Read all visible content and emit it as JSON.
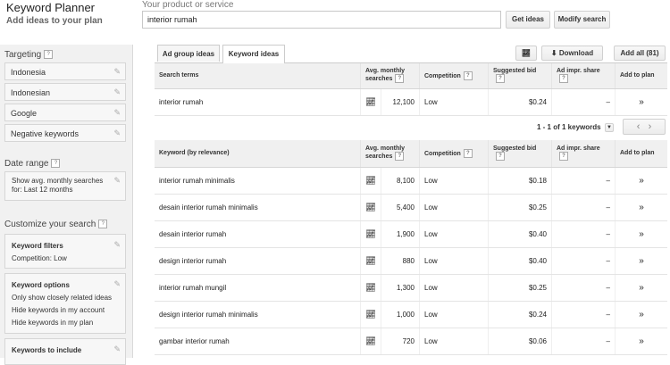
{
  "header": {
    "title": "Keyword Planner",
    "subtitle": "Add ideas to your plan",
    "product_label": "Your product or service",
    "search_value": "interior rumah",
    "get_ideas": "Get ideas",
    "modify_search": "Modify search"
  },
  "sidebar": {
    "targeting_label": "Targeting",
    "targeting": [
      "Indonesia",
      "Indonesian",
      "Google",
      "Negative keywords"
    ],
    "date_range_label": "Date range",
    "date_range_text": "Show avg. monthly searches for: Last 12 months",
    "customize_label": "Customize your search",
    "filters_title": "Keyword filters",
    "filters_line1": "Competition: Low",
    "options_title": "Keyword options",
    "options_line1": "Only show closely related ideas",
    "options_line2": "Hide keywords in my account",
    "options_line3": "Hide keywords in my plan",
    "include_title": "Keywords to include"
  },
  "tabs": {
    "ad_group": "Ad group ideas",
    "keyword": "Keyword ideas"
  },
  "toolbar": {
    "download": "Download",
    "add_all": "Add all (81)"
  },
  "search_table": {
    "headers": [
      "Search terms",
      "Avg. monthly searches",
      "Competition",
      "Suggested bid",
      "Ad impr. share",
      "Add to plan"
    ],
    "rows": [
      {
        "keyword": "interior rumah",
        "searches": "12,100",
        "competition": "Low",
        "bid": "$0.24",
        "share": "–"
      }
    ]
  },
  "pager": {
    "text": "1 - 1 of 1 keywords"
  },
  "keyword_table": {
    "headers": [
      "Keyword (by relevance)",
      "Avg. monthly searches",
      "Competition",
      "Suggested bid",
      "Ad impr. share",
      "Add to plan"
    ],
    "rows": [
      {
        "keyword": "interior rumah minimalis",
        "searches": "8,100",
        "competition": "Low",
        "bid": "$0.18",
        "share": "–"
      },
      {
        "keyword": "desain interior rumah minimalis",
        "searches": "5,400",
        "competition": "Low",
        "bid": "$0.25",
        "share": "–"
      },
      {
        "keyword": "desain interior rumah",
        "searches": "1,900",
        "competition": "Low",
        "bid": "$0.40",
        "share": "–"
      },
      {
        "keyword": "design interior rumah",
        "searches": "880",
        "competition": "Low",
        "bid": "$0.40",
        "share": "–"
      },
      {
        "keyword": "interior rumah mungil",
        "searches": "1,300",
        "competition": "Low",
        "bid": "$0.25",
        "share": "–"
      },
      {
        "keyword": "design interior rumah minimalis",
        "searches": "1,000",
        "competition": "Low",
        "bid": "$0.24",
        "share": "–"
      },
      {
        "keyword": "gambar interior rumah",
        "searches": "720",
        "competition": "Low",
        "bid": "$0.06",
        "share": "–"
      }
    ]
  }
}
